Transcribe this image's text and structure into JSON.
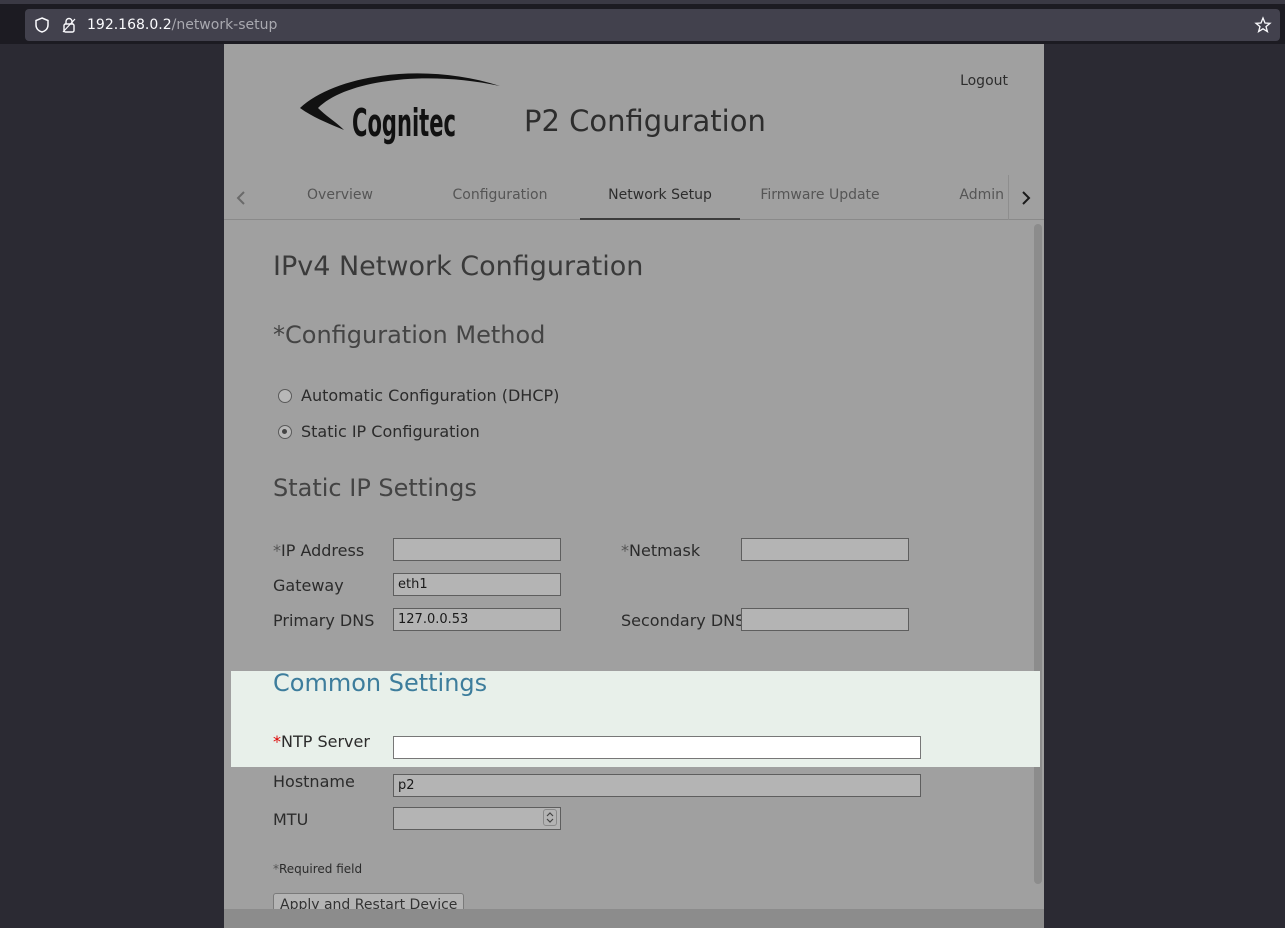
{
  "browser": {
    "url_host": "192.168.0.2",
    "url_path": "/network-setup",
    "icons": [
      "shield-icon",
      "lock-icon",
      "bookmark-star-icon"
    ]
  },
  "header": {
    "logo_text": "Cognitec",
    "title": "P2 Configuration",
    "logout": "Logout"
  },
  "tabs": [
    {
      "label": "Overview"
    },
    {
      "label": "Configuration"
    },
    {
      "label": "Network Setup"
    },
    {
      "label": "Firmware Update"
    },
    {
      "label": "Admin"
    }
  ],
  "active_tab": "Network Setup",
  "main": {
    "title": "IPv4 Network Configuration",
    "method_heading": "*Configuration Method",
    "radios": [
      {
        "label": "Automatic Configuration (DHCP)",
        "checked": false
      },
      {
        "label": "Static IP Configuration",
        "checked": true
      }
    ],
    "static_heading": "Static IP Settings",
    "fields": {
      "ip_label": "IP Address",
      "ip_value": "",
      "netmask_label": "Netmask",
      "netmask_value": "",
      "gateway_label": "Gateway",
      "gateway_value": "eth1",
      "primary_dns_label": "Primary DNS",
      "primary_dns_value": "127.0.0.53",
      "secondary_dns_label": "Secondary DNS",
      "secondary_dns_value": ""
    },
    "common_heading": "Common Settings",
    "common": {
      "ntp_label": "NTP Server",
      "ntp_value": "",
      "hostname_label": "Hostname",
      "hostname_value": "p2",
      "mtu_label": "MTU",
      "mtu_value": ""
    },
    "required_note": "Required field",
    "apply_button": "Apply and Restart Device"
  },
  "colors": {
    "page_bg": "#a0a0a0",
    "highlight_bg": "#e8f0ea",
    "accent": "#3d7d9c",
    "required_red": "#dd0000"
  }
}
